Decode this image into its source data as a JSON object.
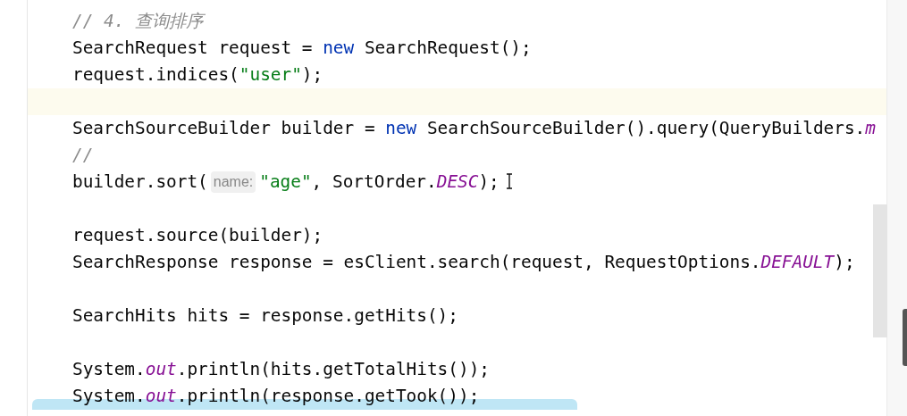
{
  "editor": {
    "lines": [
      {
        "current": false,
        "tokens": [
          {
            "kind": "comment",
            "text": "// 4. 查询排序"
          }
        ]
      },
      {
        "current": false,
        "tokens": [
          {
            "kind": "plain",
            "text": "SearchRequest request = "
          },
          {
            "kind": "keyword",
            "text": "new"
          },
          {
            "kind": "plain",
            "text": " SearchRequest();"
          }
        ]
      },
      {
        "current": false,
        "tokens": [
          {
            "kind": "plain",
            "text": "request.indices("
          },
          {
            "kind": "string",
            "text": "\"user\""
          },
          {
            "kind": "plain",
            "text": ");"
          }
        ]
      },
      {
        "current": true
      },
      {
        "current": false,
        "tokens": [
          {
            "kind": "plain",
            "text": "SearchSourceBuilder builder = "
          },
          {
            "kind": "keyword",
            "text": "new"
          },
          {
            "kind": "plain",
            "text": " SearchSourceBuilder().query(QueryBuilders."
          },
          {
            "kind": "static",
            "text": "m"
          }
        ]
      },
      {
        "current": false,
        "tokens": [
          {
            "kind": "comment",
            "text": "//"
          }
        ]
      },
      {
        "current": false,
        "tokens": [
          {
            "kind": "plain",
            "text": "builder.sort("
          },
          {
            "kind": "hint",
            "text": "name:"
          },
          {
            "kind": "string",
            "text": "\"age\""
          },
          {
            "kind": "plain",
            "text": ", SortOrder."
          },
          {
            "kind": "static",
            "text": "DESC"
          },
          {
            "kind": "plain",
            "text": ");"
          }
        ]
      },
      {
        "current": false
      },
      {
        "current": false,
        "tokens": [
          {
            "kind": "plain",
            "text": "request.source(builder);"
          }
        ]
      },
      {
        "current": false,
        "tokens": [
          {
            "kind": "plain",
            "text": "SearchResponse response = esClient.search(request, RequestOptions."
          },
          {
            "kind": "static",
            "text": "DEFAULT"
          },
          {
            "kind": "plain",
            "text": ");"
          }
        ]
      },
      {
        "current": false
      },
      {
        "current": false,
        "tokens": [
          {
            "kind": "plain",
            "text": "SearchHits hits = response.getHits();"
          }
        ]
      },
      {
        "current": false
      },
      {
        "current": false,
        "tokens": [
          {
            "kind": "plain",
            "text": "System."
          },
          {
            "kind": "static",
            "text": "out"
          },
          {
            "kind": "plain",
            "text": ".println(hits.getTotalHits());"
          }
        ]
      },
      {
        "current": false,
        "marked": true,
        "tokens": [
          {
            "kind": "plain",
            "text": "System."
          },
          {
            "kind": "static",
            "text": "out"
          },
          {
            "kind": "plain",
            "text": ".println(response.getTook());"
          }
        ]
      }
    ]
  }
}
